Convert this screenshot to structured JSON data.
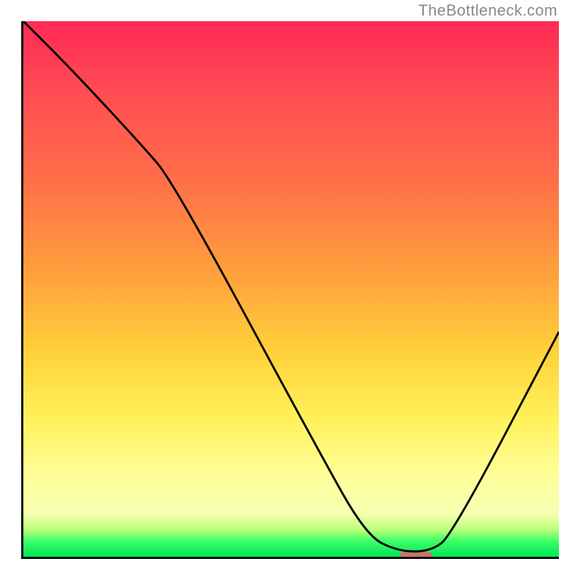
{
  "watermark": "TheBottleneck.com",
  "chart_data": {
    "type": "line",
    "title": "",
    "xlabel": "",
    "ylabel": "",
    "xlim": [
      0,
      100
    ],
    "ylim": [
      0,
      100
    ],
    "grid": false,
    "legend": false,
    "background": {
      "kind": "vertical-gradient",
      "stops": [
        {
          "pct": 0,
          "color": "#ff2a55"
        },
        {
          "pct": 30,
          "color": "#ff7048"
        },
        {
          "pct": 62,
          "color": "#ffd23a"
        },
        {
          "pct": 85,
          "color": "#ffff9a"
        },
        {
          "pct": 95,
          "color": "#b8ff7a"
        },
        {
          "pct": 100,
          "color": "#00e658"
        }
      ]
    },
    "series": [
      {
        "name": "bottleneck-curve",
        "color": "#000000",
        "x": [
          0,
          9,
          22,
          28,
          55,
          64,
          70,
          76,
          80,
          100
        ],
        "values": [
          100,
          91,
          77,
          70,
          20,
          4,
          1,
          1,
          4,
          42
        ]
      }
    ],
    "marker": {
      "name": "optimal-range",
      "color": "#d66a6a",
      "x_start": 70,
      "x_end": 76,
      "y": 0.5
    }
  }
}
